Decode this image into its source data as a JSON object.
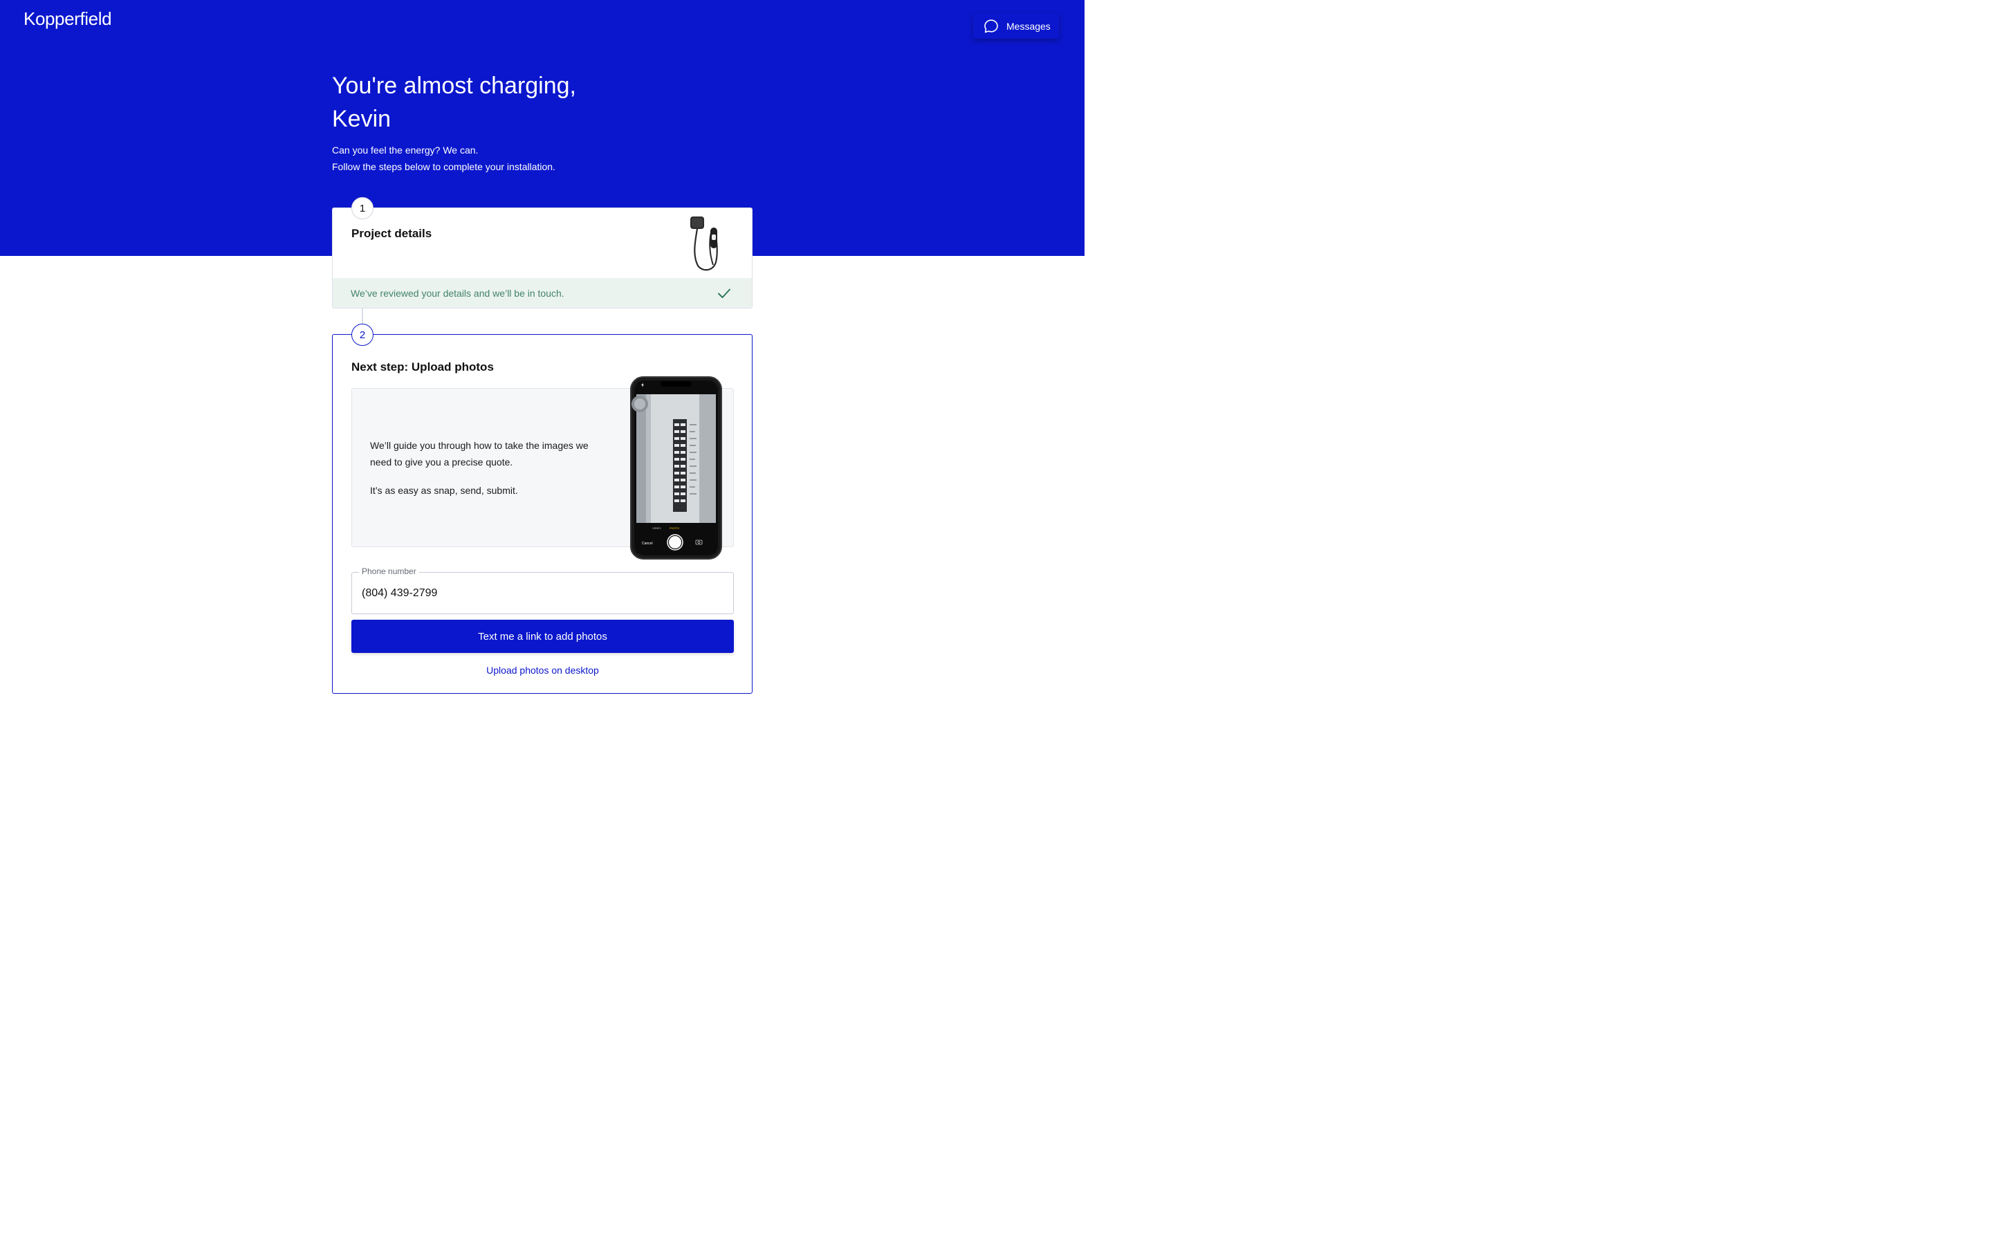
{
  "header": {
    "logo": "Kopperfield",
    "messages_label": "Messages"
  },
  "hero": {
    "title": "You're almost charging, Kevin",
    "subtitle_line1": "Can you feel the energy? We can.",
    "subtitle_line2": "Follow the steps below to complete your installation."
  },
  "steps": [
    {
      "number": "1",
      "title": "Project details",
      "status": "We’ve reviewed your details and we’ll be in touch.",
      "icon": "checkmark-icon"
    },
    {
      "number": "2",
      "title": "Next step: Upload photos",
      "guide_line1": "We’ll guide you through how to take the images we need to give you a precise quote.",
      "guide_line2": "It’s as easy as snap, send, submit.",
      "phone_label": "Phone number",
      "phone_value": "(804) 439-2799",
      "cta_label": "Text me a link to add photos",
      "desktop_link": "Upload photos on desktop",
      "camera": {
        "mode_video": "VIDEO",
        "mode_photo": "PHOTO",
        "cancel": "Cancel"
      }
    }
  ],
  "colors": {
    "brand": "#0b17cc",
    "success_text": "#43846a",
    "success_bg": "#ebf3ef"
  }
}
